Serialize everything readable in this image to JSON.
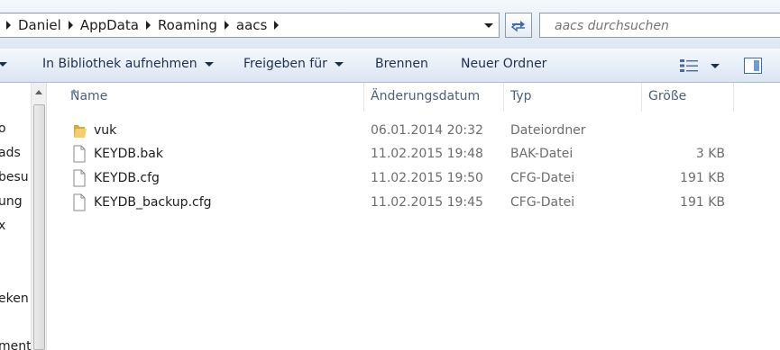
{
  "address": {
    "breadcrumbs": [
      "Daniel",
      "AppData",
      "Roaming",
      "aacs"
    ]
  },
  "search": {
    "placeholder": "aacs durchsuchen"
  },
  "toolbar": {
    "library_label": "In Bibliothek aufnehmen",
    "share_label": "Freigeben für",
    "burn_label": "Brennen",
    "new_folder_label": "Neuer Ordner"
  },
  "nav": {
    "items": [
      "o",
      "ads",
      "besu",
      "ung",
      "x",
      "eken",
      "ment"
    ]
  },
  "columns": {
    "name": "Name",
    "date": "Änderungsdatum",
    "type": "Typ",
    "size": "Größe"
  },
  "files": [
    {
      "name": "vuk",
      "date": "06.01.2014 20:32",
      "type": "Dateiordner",
      "size": "",
      "icon": "folder-icon"
    },
    {
      "name": "KEYDB.bak",
      "date": "11.02.2015 19:48",
      "type": "BAK-Datei",
      "size": "3 KB",
      "icon": "file-icon"
    },
    {
      "name": "KEYDB.cfg",
      "date": "11.02.2015 19:50",
      "type": "CFG-Datei",
      "size": "191 KB",
      "icon": "file-icon"
    },
    {
      "name": "KEYDB_backup.cfg",
      "date": "11.02.2015 19:45",
      "type": "CFG-Datei",
      "size": "191 KB",
      "icon": "file-icon"
    }
  ],
  "colors": {
    "toolbar_text": "#1e3050",
    "header_text": "#4c607a",
    "folder": "#e8c15a"
  }
}
